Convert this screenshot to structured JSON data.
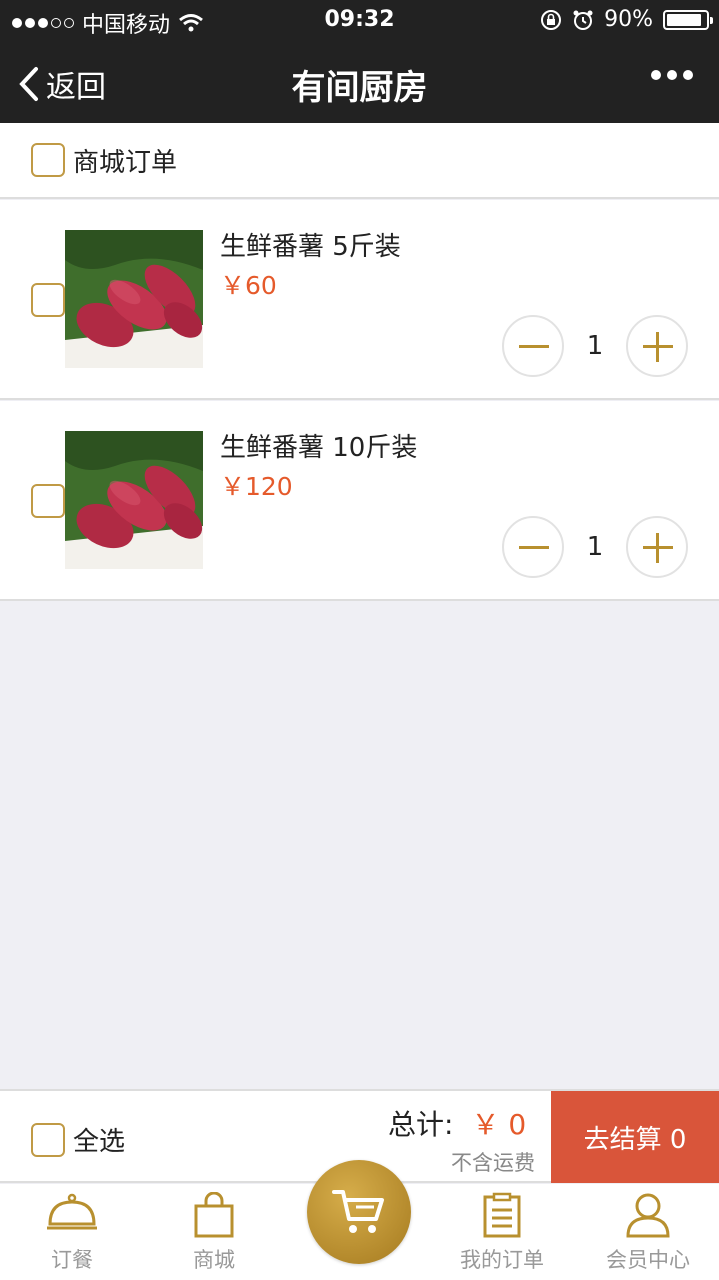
{
  "status_bar": {
    "carrier": "中国移动",
    "time": "09:32",
    "battery": "90%"
  },
  "nav": {
    "back_label": "返回",
    "title": "有间厨房"
  },
  "section": {
    "label": "商城订单"
  },
  "items": [
    {
      "name": "生鲜番薯 5斤装",
      "price": "￥60",
      "quantity": "1"
    },
    {
      "name": "生鲜番薯 10斤装",
      "price": "￥120",
      "quantity": "1"
    }
  ],
  "footer": {
    "select_all_label": "全选",
    "total_label": "总计:",
    "total_value": "￥ 0",
    "shipping_note": "不含运费",
    "checkout_label": "去结算 0"
  },
  "tabs": [
    {
      "label": "订餐",
      "icon": "dish-icon"
    },
    {
      "label": "商城",
      "icon": "bag-icon"
    },
    {
      "label": "",
      "icon": "cart-icon"
    },
    {
      "label": "我的订单",
      "icon": "clipboard-icon"
    },
    {
      "label": "会员中心",
      "icon": "user-icon"
    }
  ],
  "colors": {
    "accent_gold": "#b8902f",
    "price_red": "#e55a2b",
    "checkout_red": "#d9553a",
    "nav_dark": "#222222"
  }
}
